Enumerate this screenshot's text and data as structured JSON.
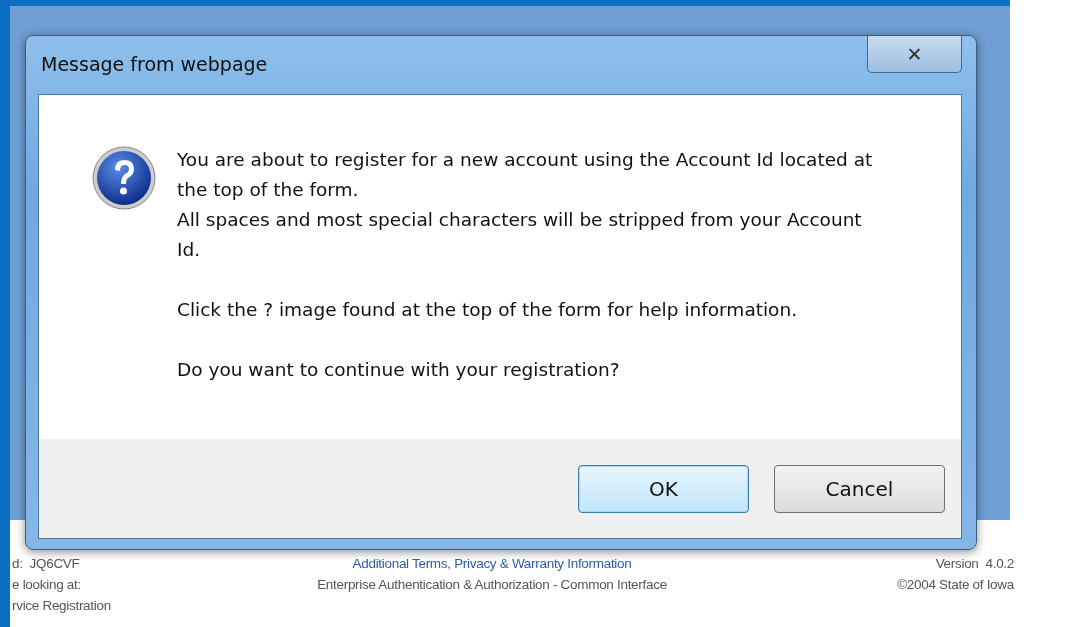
{
  "dialog": {
    "title": "Message from webpage",
    "close": "✕",
    "message_blocks": [
      [
        "You are about to register for a new account using the Account Id located at the top of the form.",
        "All spaces and most special characters will be stripped from your Account Id."
      ],
      [
        "Click the ? image found at the top of the form for help information."
      ],
      [
        "Do you want to continue with your registration?"
      ]
    ],
    "buttons": [
      {
        "label": "OK",
        "default": true
      },
      {
        "label": "Cancel",
        "default": false
      }
    ]
  },
  "footer": {
    "left": [
      "d:  JQ6CVF",
      "e looking at:",
      "rvice Registration"
    ],
    "center": [
      {
        "text": "Additional Terms, Privacy & Warranty Information",
        "kind": "link"
      },
      {
        "text": "Enterprise Authentication & Authorization - Common Interface",
        "kind": "text"
      }
    ],
    "right": [
      "Version  4.0.2",
      "©2004 State of Iowa"
    ]
  }
}
